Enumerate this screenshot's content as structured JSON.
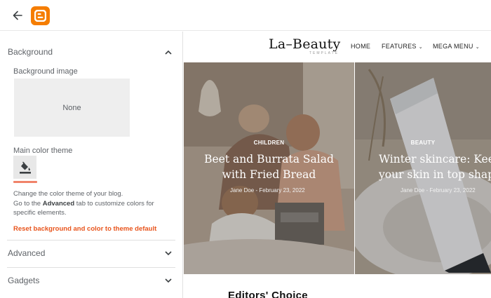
{
  "topbar": {
    "back_icon": "arrow-left-icon",
    "logo_icon": "blogger-logo-icon",
    "logo_color": "#f57d00"
  },
  "panel": {
    "background_section": {
      "title": "Background",
      "image_label": "Background image",
      "image_value": "None",
      "theme_label": "Main color theme",
      "theme_icon": "paint-bucket-icon",
      "help_line1": "Change the color theme of your blog.",
      "help_line2_pre": "Go to the ",
      "help_line2_bold": "Advanced",
      "help_line2_post": " tab to customize colors for",
      "help_line3": "specific elements.",
      "reset_label": "Reset background and color to theme default",
      "accent_color": "#e8541c"
    },
    "advanced_section": {
      "title": "Advanced"
    },
    "gadgets_section": {
      "title": "Gadgets"
    }
  },
  "preview": {
    "brand_name": "La–Beauty",
    "brand_sub": "TEMPLATE",
    "nav": {
      "home": "HOME",
      "features": "FEATURES",
      "mega_menu": "MEGA MENU"
    },
    "cards": [
      {
        "category": "CHILDREN",
        "title_line1": "Beet and Burrata Salad",
        "title_line2": "with Fried Bread",
        "meta": "Jane Doe - February 23, 2022"
      },
      {
        "category": "BEAUTY",
        "title_line1": "Winter skincare: Kee",
        "title_line2": "your skin in top shap",
        "meta": "Jane Doe - February 23, 2022"
      }
    ],
    "section_heading": "Editors' Choice"
  }
}
